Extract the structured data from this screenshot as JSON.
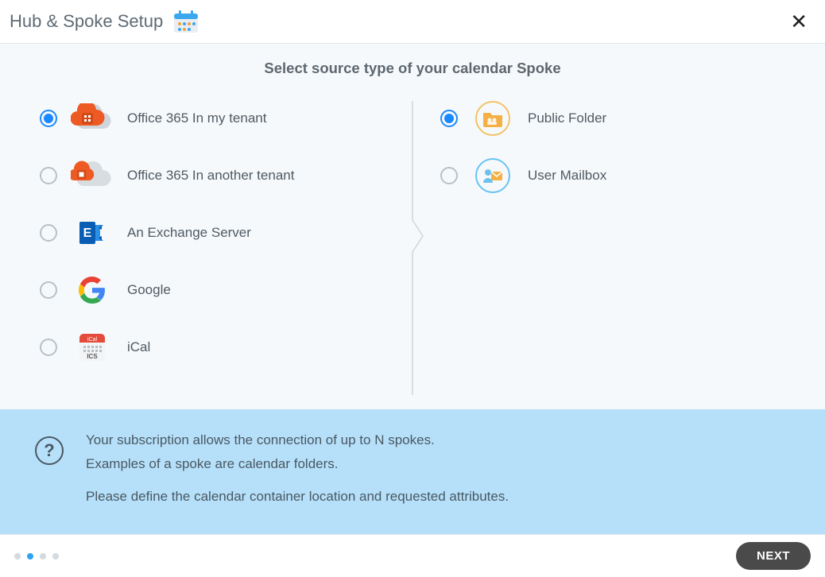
{
  "header": {
    "title": "Hub & Spoke Setup"
  },
  "subtitle": "Select source type of your calendar Spoke",
  "left_options": [
    {
      "label": "Office 365 In my tenant",
      "selected": true,
      "icon": "o365-own"
    },
    {
      "label": "Office 365 In another tenant",
      "selected": false,
      "icon": "o365-other"
    },
    {
      "label": "An Exchange Server",
      "selected": false,
      "icon": "exchange"
    },
    {
      "label": "Google",
      "selected": false,
      "icon": "google"
    },
    {
      "label": "iCal",
      "selected": false,
      "icon": "ical"
    }
  ],
  "right_options": [
    {
      "label": "Public Folder",
      "selected": true,
      "icon": "public-folder"
    },
    {
      "label": "User Mailbox",
      "selected": false,
      "icon": "user-mailbox"
    }
  ],
  "info": {
    "line1": "Your subscription allows the connection of up to N spokes.",
    "line2": "Examples of a spoke are calendar folders.",
    "line3": "Please define the calendar container location and requested attributes."
  },
  "steps": {
    "total": 4,
    "current_index": 1
  },
  "footer": {
    "next_label": "NEXT"
  }
}
